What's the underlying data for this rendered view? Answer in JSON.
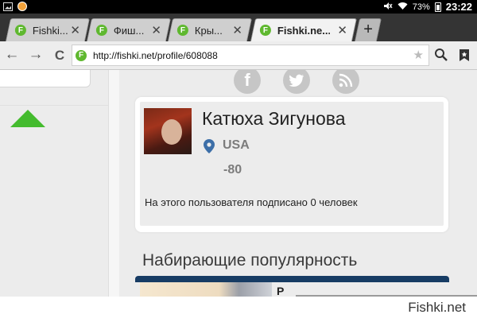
{
  "status_bar": {
    "battery": "73%",
    "time": "23:22"
  },
  "tabs": [
    {
      "label": "Fishki...",
      "favicon": "F",
      "active": false
    },
    {
      "label": "Фиш...",
      "favicon": "F",
      "active": false
    },
    {
      "label": "Кры...",
      "favicon": "F",
      "active": false
    },
    {
      "label": "Fishki.ne...",
      "favicon": "F",
      "active": true
    }
  ],
  "new_tab_label": "+",
  "nav": {
    "back": "←",
    "forward": "→",
    "reload": "C",
    "url": "http://fishki.net/profile/608088",
    "favicon": "F"
  },
  "social": {
    "facebook": "f",
    "twitter": "twitter-icon",
    "rss": "rss-icon"
  },
  "profile": {
    "name": "Катюха Зигунова",
    "country": "USA",
    "rating": "-80",
    "subscribers_text": "На этого пользователя подписано 0 человек"
  },
  "section_title": "Набирающие популярность",
  "card_letter": "Р",
  "watermark": "Fishki.net",
  "colors": {
    "accent_green": "#44bb2e",
    "favicon_green": "#5fb82f",
    "navy": "#173c64"
  }
}
